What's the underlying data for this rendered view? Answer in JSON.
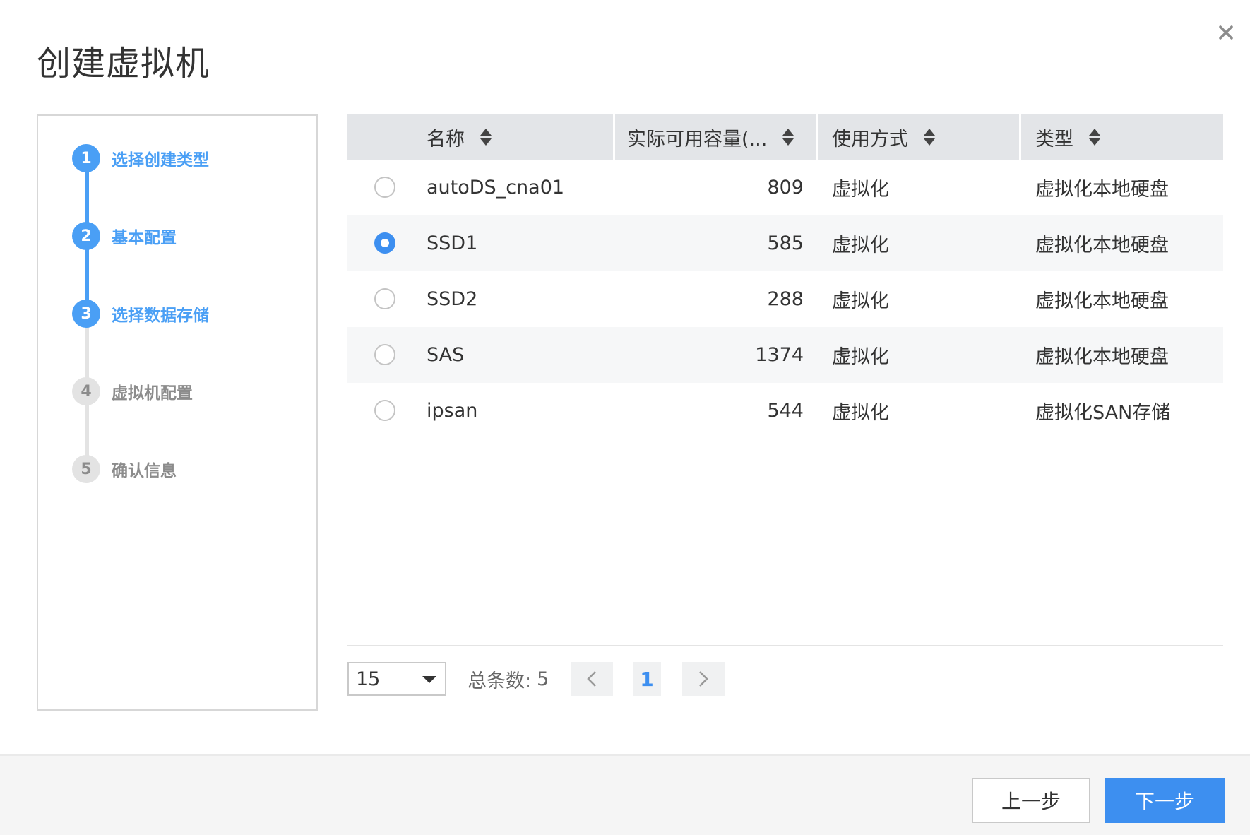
{
  "dialog": {
    "title": "创建虚拟机"
  },
  "steps": [
    {
      "number": "1",
      "label": "选择创建类型",
      "state": "active"
    },
    {
      "number": "2",
      "label": "基本配置",
      "state": "active"
    },
    {
      "number": "3",
      "label": "选择数据存储",
      "state": "active"
    },
    {
      "number": "4",
      "label": "虚拟机配置",
      "state": "inactive"
    },
    {
      "number": "5",
      "label": "确认信息",
      "state": "inactive"
    }
  ],
  "table": {
    "columns": [
      "名称",
      "实际可用容量(...",
      "使用方式",
      "类型"
    ],
    "rows": [
      {
        "name": "autoDS_cna01",
        "capacity": "809",
        "usage": "虚拟化",
        "type": "虚拟化本地硬盘",
        "selected": false
      },
      {
        "name": "SSD1",
        "capacity": "585",
        "usage": "虚拟化",
        "type": "虚拟化本地硬盘",
        "selected": true
      },
      {
        "name": "SSD2",
        "capacity": "288",
        "usage": "虚拟化",
        "type": "虚拟化本地硬盘",
        "selected": false
      },
      {
        "name": "SAS",
        "capacity": "1374",
        "usage": "虚拟化",
        "type": "虚拟化本地硬盘",
        "selected": false
      },
      {
        "name": "ipsan",
        "capacity": "544",
        "usage": "虚拟化",
        "type": "虚拟化SAN存储",
        "selected": false
      }
    ]
  },
  "pagination": {
    "page_size": "15",
    "total_label": "总条数:",
    "total_value": "5",
    "current_page": "1"
  },
  "footer": {
    "prev_label": "上一步",
    "next_label": "下一步"
  },
  "colors": {
    "accent": "#3d8ff0",
    "step_active": "#4a9ff5",
    "step_inactive": "#e3e3e3"
  }
}
